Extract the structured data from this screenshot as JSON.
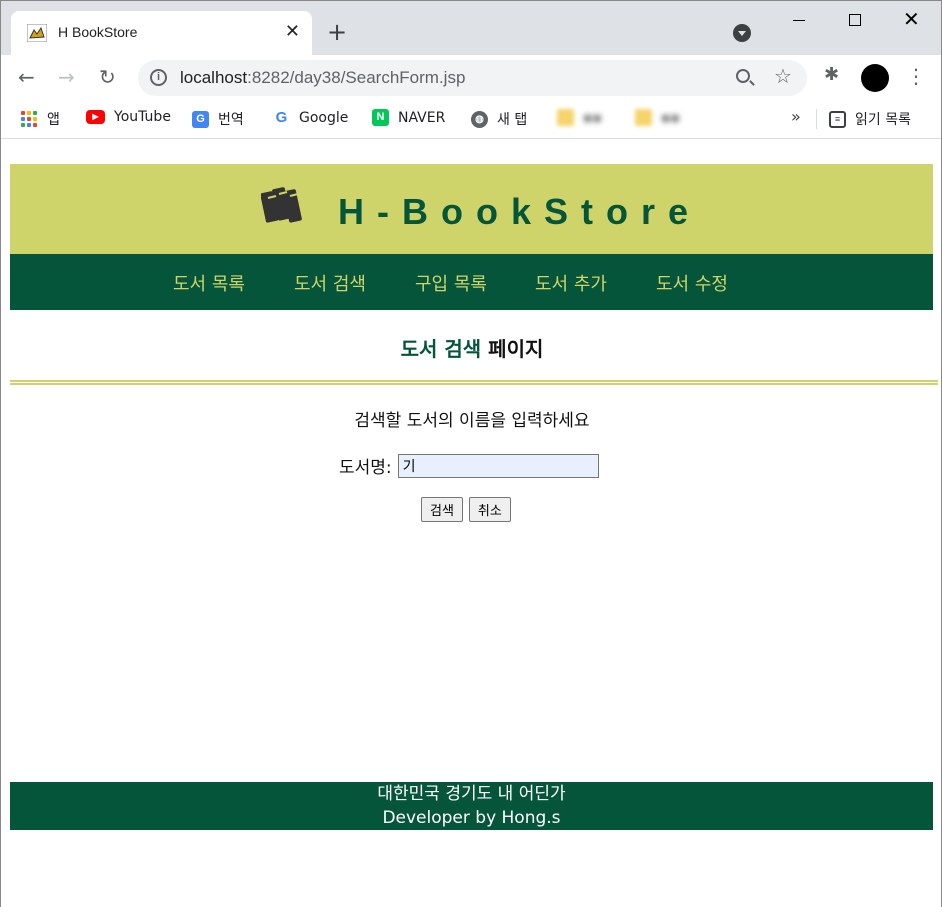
{
  "browser": {
    "tab_title": "H BookStore",
    "url_host": "localhost",
    "url_rest": ":8282/day38/SearchForm.jsp",
    "bookmarks": [
      {
        "label": "앱",
        "icon": "apps-grid-icon"
      },
      {
        "label": "YouTube",
        "icon": "youtube-icon"
      },
      {
        "label": "번역",
        "icon": "translate-icon"
      },
      {
        "label": "Google",
        "icon": "google-icon"
      },
      {
        "label": "NAVER",
        "icon": "naver-icon"
      },
      {
        "label": "새 탭",
        "icon": "globe-icon"
      }
    ],
    "reading_list": "읽기 목록"
  },
  "site": {
    "title": "H-BookStore",
    "nav": [
      "도서 목록",
      "도서 검색",
      "구입 목록",
      "도서 추가",
      "도서 수정"
    ],
    "heading_accent": "도서 검색",
    "heading_rest": " 페이지",
    "prompt": "검색할 도서의 이름을 입력하세요",
    "field_label": "도서명:",
    "field_value": "기",
    "search_button": "검색",
    "cancel_button": "취소",
    "footer_line1": "대한민국 경기도 내 어딘가",
    "footer_line2": "Developer by Hong.s"
  },
  "colors": {
    "header_bg": "#cfd46a",
    "nav_bg": "#05553a",
    "nav_text": "#cfd46a",
    "title_text": "#05553a"
  }
}
